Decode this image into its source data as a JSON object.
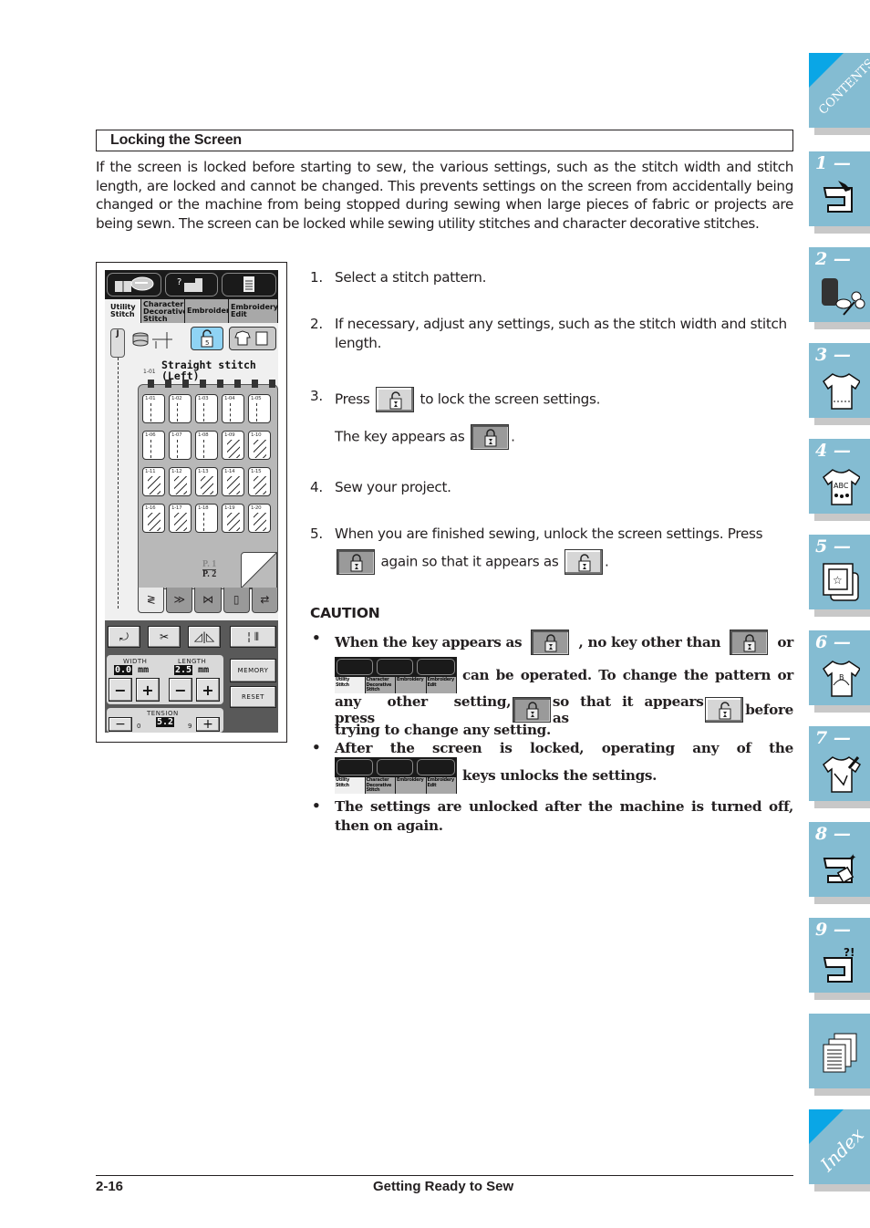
{
  "section": {
    "heading": "Locking the Screen",
    "intro": "If the screen is locked before starting to sew, the various settings, such as the stitch width and stitch length, are locked and cannot be changed. This prevents settings on the screen from accidentally being changed or the machine from being stopped during sewing when large pieces of fabric or projects are being sewn. The screen can be locked while sewing utility stitches and character decorative stitches."
  },
  "screen": {
    "tabs": [
      "Utility Stitch",
      "Character Decorative Stitch",
      "Embroidery",
      "Embroidery Edit"
    ],
    "presser_foot": "J",
    "stitch_name_line1": "Straight stitch",
    "stitch_name_line2": "(Left)",
    "stitch_code": "1-01",
    "stitch_cells": [
      "1-01",
      "1-02",
      "1-03",
      "1-04",
      "1-05",
      "1-06",
      "1-07",
      "1-08",
      "1-09",
      "1-10",
      "1-11",
      "1-12",
      "1-13",
      "1-14",
      "1-15",
      "1-16",
      "1-17",
      "1-18",
      "1-19",
      "1-20"
    ],
    "page_current": "P. 1",
    "page_total": "P. 2",
    "width_label": "WIDTH",
    "width_value": "0.0",
    "length_label": "LENGTH",
    "length_value": "2.5",
    "unit": "mm",
    "memory_label": "MEMORY",
    "reset_label": "RESET",
    "tension_label": "TENSION",
    "tension_value": "5.2",
    "tension_min": "0",
    "tension_max": "9",
    "minus": "−",
    "plus": "+"
  },
  "steps": [
    {
      "num": "1.",
      "text": "Select a stitch pattern."
    },
    {
      "num": "2.",
      "text": "If necessary, adjust any settings, such as the stitch width and stitch length."
    },
    {
      "num": "3.",
      "text_before": "Press",
      "text_after": "to lock the screen settings."
    },
    {
      "sub_before": "The key appears as",
      "sub_after": "."
    },
    {
      "num": "4.",
      "text": "Sew your project."
    },
    {
      "num": "5.",
      "text": "When you are finished sewing, unlock the screen settings. Press",
      "line2_after": "again so that it appears as",
      "line2_end": "."
    }
  ],
  "caution": {
    "title": "CAUTION",
    "bullet_symbol": "•",
    "b1_a": "When the key appears as",
    "b1_b": ", no key other than",
    "b1_c": "or",
    "b1_d": "can be operated. To change the pattern or",
    "b1_e": "any other setting, press",
    "b1_f": "so that it appears as",
    "b1_g": "before",
    "b1_h": "trying to change any setting.",
    "b2_a": "After the screen is locked, operating any of the",
    "b2_b": "keys unlocks the settings.",
    "b3": "The settings are unlocked after the machine is turned off, then on again."
  },
  "sidebar": {
    "contents_label": "CONTENTS",
    "chapters": [
      "1 —",
      "2 —",
      "3 —",
      "4 —",
      "5 —",
      "6 —",
      "7 —",
      "8 —",
      "9 —"
    ],
    "index_label": "Index",
    "tab_color": "#84bcd2",
    "corner_color": "#0aa6e6"
  },
  "footer": {
    "page_number": "2-16",
    "chapter_title": "Getting Ready to Sew"
  }
}
